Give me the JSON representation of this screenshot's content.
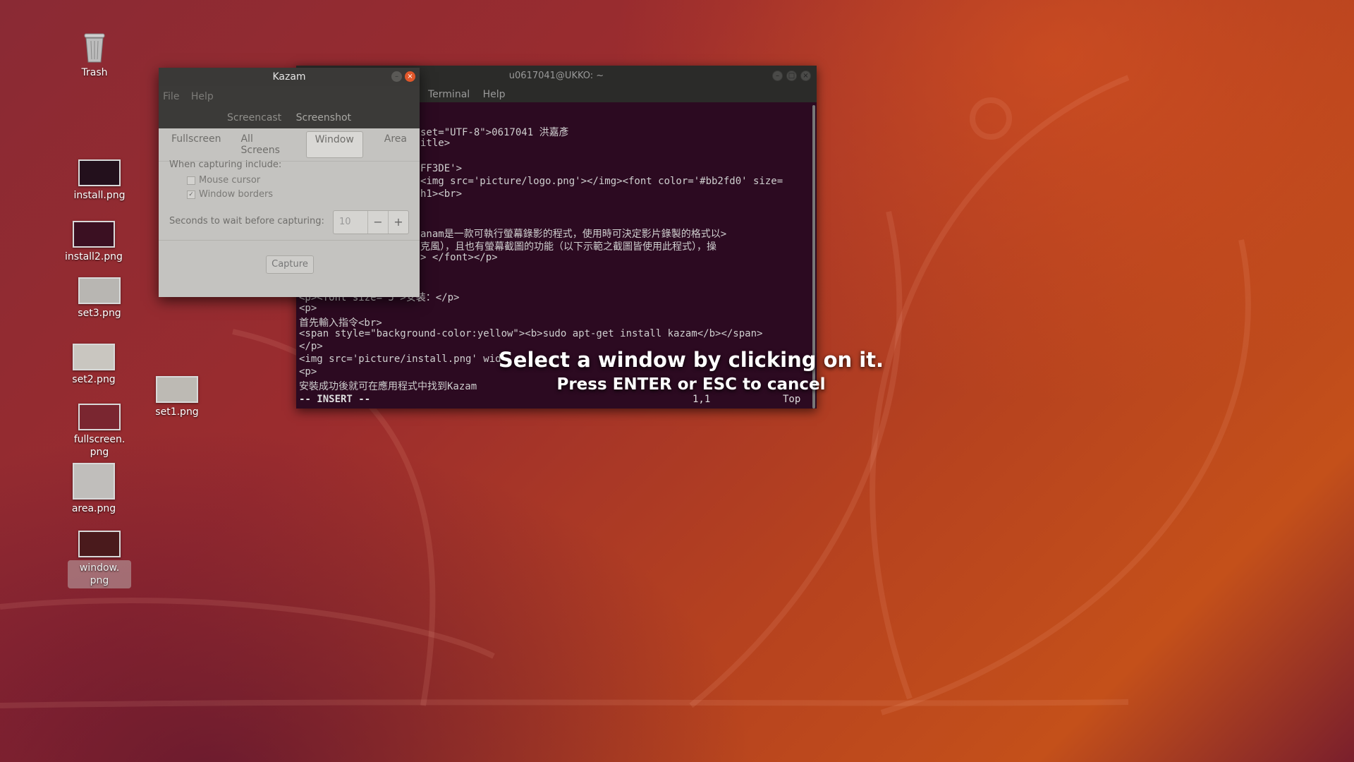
{
  "desktop": {
    "icons": [
      {
        "label": "Trash"
      },
      {
        "label": "install.png"
      },
      {
        "label": "install2.png"
      },
      {
        "label": "set3.png"
      },
      {
        "label": "set2.png"
      },
      {
        "label": "set1.png"
      },
      {
        "label": "fullscreen.\npng"
      },
      {
        "label": "area.png"
      },
      {
        "label": "window.\npng"
      }
    ]
  },
  "terminal": {
    "title": "u0617041@UKKO: ~",
    "menu": [
      "Terminal",
      "Help"
    ],
    "lines": [
      "set=\"UTF-8\">0617041 洪嘉彥",
      "itle>",
      "",
      "FF3DE'>",
      "<img src='picture/logo.png'></img><font color='#bb2fd0' size=",
      "h1><br>",
      "",
      "",
      "anam是一款可執行螢幕錄影的程式，使用時可決定影片錄製的格式以>",
      "克風），且也有螢幕截圖的功能（以下示範之截圖皆使用此程式），操",
      "> </font></p>",
      "",
      "",
      "<p><font size='5'>安裝：</p>",
      "<p>",
      "首先輸入指令<br>",
      "<span style=\"background-color:yellow\"><b>sudo apt-get install kazam</b></span>",
      "</p>",
      "<img src='picture/install.png' wid",
      "<p>",
      "安裝成功後就可在應用程式中找到Kazam"
    ],
    "status": {
      "mode": "-- INSERT --",
      "position": "1,1",
      "scroll": "Top"
    }
  },
  "kazam": {
    "title": "Kazam",
    "menu": {
      "file": "File",
      "help": "Help"
    },
    "modes": {
      "screencast": "Screencast",
      "screenshot": "Screenshot"
    },
    "tabs": {
      "fullscreen": "Fullscreen",
      "all_screens": "All Screens",
      "window": "Window",
      "area": "Area"
    },
    "include_label": "When capturing include:",
    "mouse_cursor": "Mouse cursor",
    "window_borders": "Window borders",
    "seconds_label": "Seconds to wait before capturing:",
    "seconds_value": "10",
    "minus": "−",
    "plus": "+",
    "capture": "Capture"
  },
  "overlay": {
    "line1": "Select a window by clicking on it.",
    "line2": "Press ENTER or ESC to cancel"
  }
}
